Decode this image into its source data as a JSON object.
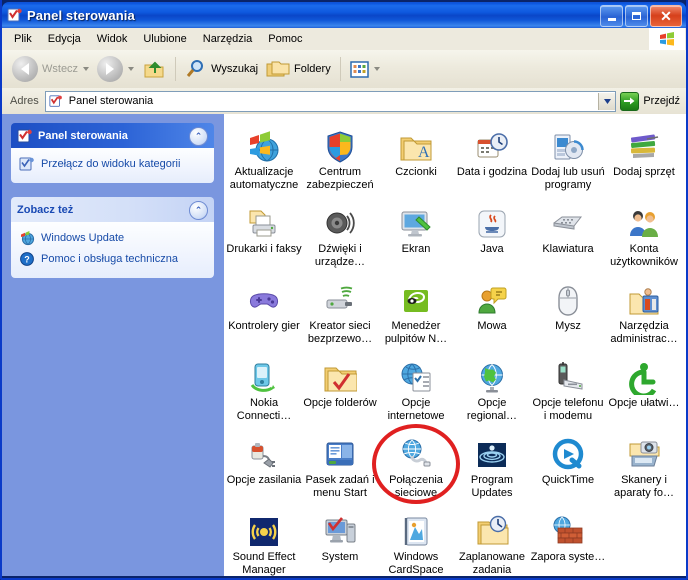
{
  "window": {
    "title": "Panel sterowania",
    "title_icon": "control-panel-icon",
    "buttons": {
      "minimize": "_",
      "maximize": "□",
      "close": "✕"
    }
  },
  "menu": {
    "items": [
      {
        "label": "Plik"
      },
      {
        "label": "Edycja"
      },
      {
        "label": "Widok"
      },
      {
        "label": "Ulubione"
      },
      {
        "label": "Narzędzia"
      },
      {
        "label": "Pomoc"
      }
    ],
    "flag_icon": "windows-flag-icon"
  },
  "toolbar": {
    "back_label": "Wstecz",
    "back_icon": "back-arrow-icon",
    "forward_icon": "forward-arrow-icon",
    "up_icon": "up-folder-icon",
    "search_label": "Wyszukaj",
    "search_icon": "magnifier-icon",
    "folders_label": "Foldery",
    "folders_icon": "folders-icon",
    "views_icon": "views-grid-icon"
  },
  "address": {
    "label": "Adres",
    "value": "Panel sterowania",
    "icon": "control-panel-icon",
    "dropdown_icon": "chevron-down-icon",
    "go_label": "Przejdź",
    "go_icon": "go-arrow-icon"
  },
  "sidebar": {
    "panels": [
      {
        "title": "Panel sterowania",
        "style": "blue",
        "header_icon": "control-panel-switch-icon",
        "collapse_icon": "chevron-up-icon",
        "links": [
          {
            "label": "Przełącz do widoku kategorii",
            "icon": "category-view-icon"
          }
        ]
      },
      {
        "title": "Zobacz też",
        "style": "light",
        "collapse_icon": "chevron-up-icon",
        "links": [
          {
            "label": "Windows Update",
            "icon": "windows-update-icon"
          },
          {
            "label": "Pomoc i obsługa techniczna",
            "icon": "help-support-icon"
          }
        ]
      }
    ]
  },
  "content": {
    "columns": 6,
    "items": [
      {
        "label": "Aktualizacje automatyczne",
        "icon": "automatic-updates-icon"
      },
      {
        "label": "Centrum zabezpieczeń",
        "icon": "security-center-icon"
      },
      {
        "label": "Czcionki",
        "icon": "fonts-folder-icon"
      },
      {
        "label": "Data i godzina",
        "icon": "date-time-icon"
      },
      {
        "label": "Dodaj lub usuń programy",
        "icon": "add-remove-programs-icon"
      },
      {
        "label": "Dodaj sprzęt",
        "icon": "add-hardware-icon"
      },
      {
        "label": "Drukarki i faksy",
        "icon": "printers-faxes-icon"
      },
      {
        "label": "Dźwięki i urządze…",
        "icon": "sounds-audio-icon"
      },
      {
        "label": "Ekran",
        "icon": "display-icon"
      },
      {
        "label": "Java",
        "icon": "java-icon"
      },
      {
        "label": "Klawiatura",
        "icon": "keyboard-icon"
      },
      {
        "label": "Konta użytkowników",
        "icon": "user-accounts-icon"
      },
      {
        "label": "Kontrolery gier",
        "icon": "game-controllers-icon"
      },
      {
        "label": "Kreator sieci bezprzewo…",
        "icon": "wireless-network-wizard-icon"
      },
      {
        "label": "Menedżer pulpitów N…",
        "icon": "nvidia-desktop-manager-icon"
      },
      {
        "label": "Mowa",
        "icon": "speech-icon"
      },
      {
        "label": "Mysz",
        "icon": "mouse-icon"
      },
      {
        "label": "Narzędzia administrac…",
        "icon": "administrative-tools-icon"
      },
      {
        "label": "Nokia Connecti…",
        "icon": "nokia-connectivity-icon"
      },
      {
        "label": "Opcje folderów",
        "icon": "folder-options-icon"
      },
      {
        "label": "Opcje internetowe",
        "icon": "internet-options-icon"
      },
      {
        "label": "Opcje regional…",
        "icon": "regional-options-icon"
      },
      {
        "label": "Opcje telefonu i modemu",
        "icon": "phone-modem-options-icon"
      },
      {
        "label": "Opcje ułatwi…",
        "icon": "accessibility-options-icon"
      },
      {
        "label": "Opcje zasilania",
        "icon": "power-options-icon"
      },
      {
        "label": "Pasek zadań i menu Start",
        "icon": "taskbar-start-menu-icon"
      },
      {
        "label": "Połączenia sieciowe",
        "icon": "network-connections-icon",
        "highlighted": true
      },
      {
        "label": "Program Updates",
        "icon": "program-updates-icon"
      },
      {
        "label": "QuickTime",
        "icon": "quicktime-icon"
      },
      {
        "label": "Skanery i aparaty fo…",
        "icon": "scanners-cameras-icon"
      },
      {
        "label": "Sound Effect Manager",
        "icon": "sound-effect-manager-icon"
      },
      {
        "label": "System",
        "icon": "system-icon"
      },
      {
        "label": "Windows CardSpace",
        "icon": "windows-cardspace-icon"
      },
      {
        "label": "Zaplanowane zadania",
        "icon": "scheduled-tasks-icon"
      },
      {
        "label": "Zapora syste…",
        "icon": "windows-firewall-icon"
      }
    ]
  },
  "annotation": {
    "shape": "ellipse",
    "color": "#E02020",
    "target": "Połączenia sieciowe"
  },
  "colors": {
    "titlebar_blue": "#0A46C8",
    "sidebar_blue": "#7A96DF",
    "panel_header_blue": "#2C63D6",
    "link_blue": "#174BA8",
    "annotation_red": "#E02020",
    "toolbar_beige": "#EDEADE"
  }
}
